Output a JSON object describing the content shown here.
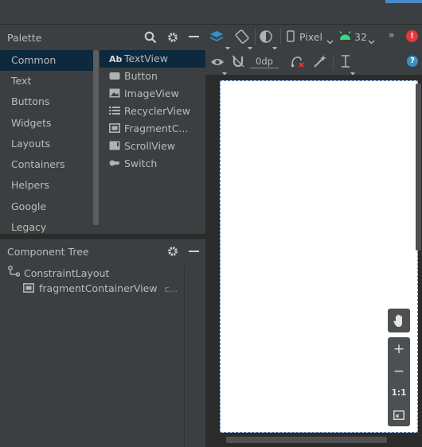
{
  "palette": {
    "title": "Palette",
    "categories": [
      "Common",
      "Text",
      "Buttons",
      "Widgets",
      "Layouts",
      "Containers",
      "Helpers",
      "Google",
      "Legacy"
    ],
    "selected_category": "Common",
    "items": [
      {
        "label": "TextView",
        "icon": "textview-icon",
        "prefix": "Ab"
      },
      {
        "label": "Button",
        "icon": "button-icon"
      },
      {
        "label": "ImageView",
        "icon": "imageview-icon"
      },
      {
        "label": "RecyclerView",
        "icon": "recyclerview-icon"
      },
      {
        "label": "FragmentC...",
        "icon": "fragment-icon"
      },
      {
        "label": "ScrollView",
        "icon": "scrollview-icon"
      },
      {
        "label": "Switch",
        "icon": "switch-icon"
      }
    ]
  },
  "component_tree": {
    "title": "Component Tree",
    "nodes": [
      {
        "label": "ConstraintLayout",
        "icon": "constraint-layout-icon"
      },
      {
        "label": "fragmentContainerView",
        "suffix": "c...",
        "icon": "fragment-container-icon"
      }
    ]
  },
  "toolbar": {
    "device": "Pixel",
    "api_level": "32",
    "margin": "0dp"
  },
  "zoom": {
    "zoom_in": "+",
    "zoom_out": "−",
    "actual_size": "1:1"
  },
  "colors": {
    "panel": "#3c3f41",
    "background": "#2b2b2b",
    "selection": "#0d293e",
    "accent_blue": "#4a88c7",
    "android_green": "#3ddc84",
    "error_red": "#e8383d",
    "help_blue": "#3592c4"
  }
}
